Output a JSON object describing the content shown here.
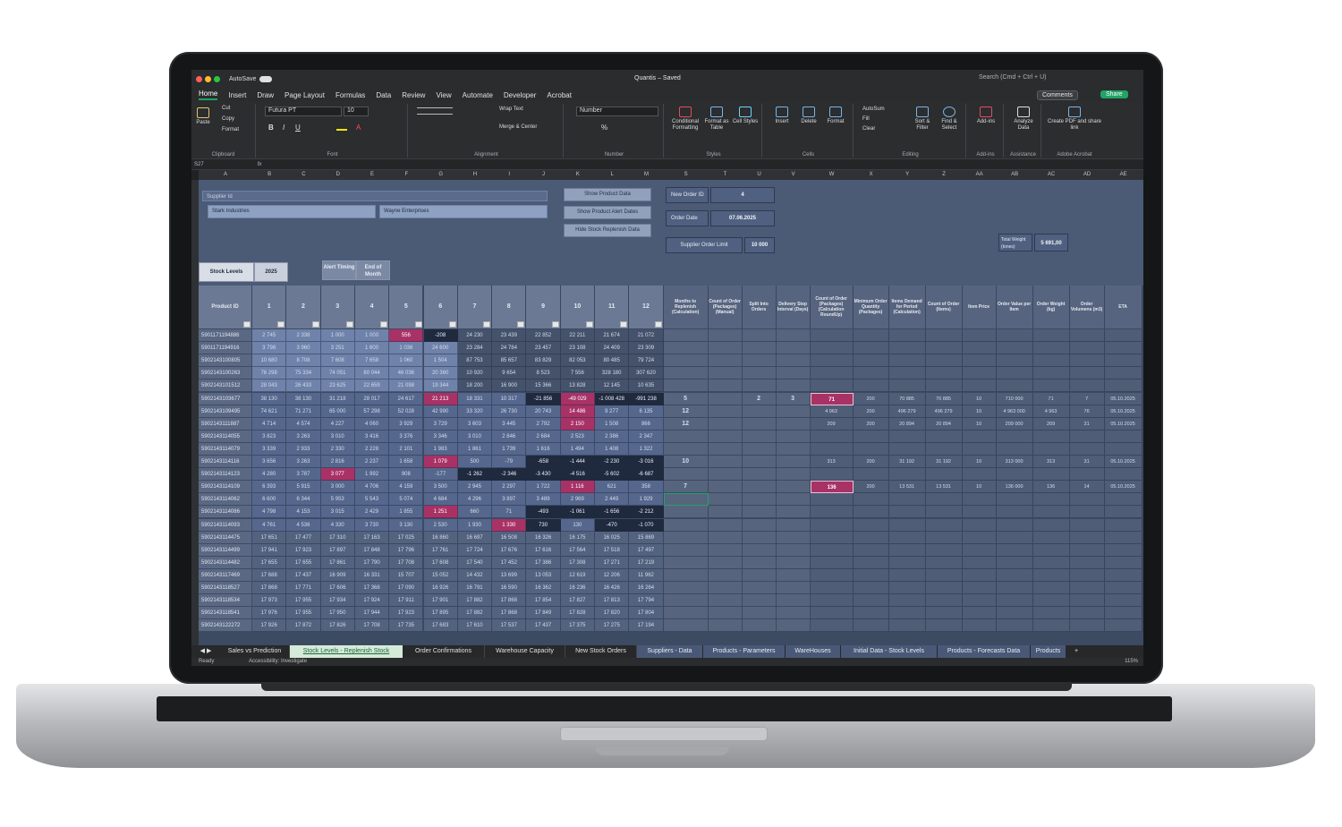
{
  "window": {
    "title": "Quantis – Saved",
    "autosave": "AutoSave",
    "search_placeholder": "Search (Cmd + Ctrl + U)",
    "comments": "Comments",
    "share": "Share"
  },
  "menu": [
    "Home",
    "Insert",
    "Draw",
    "Page Layout",
    "Formulas",
    "Data",
    "Review",
    "View",
    "Automate",
    "Developer",
    "Acrobat"
  ],
  "ribbon": {
    "paste": "Paste",
    "cut": "Cut",
    "copy": "Copy",
    "format": "Format",
    "clipboard": "Clipboard",
    "font_name": "Futura PT",
    "font_size": "10",
    "font_group": "Font",
    "wrap_text": "Wrap Text",
    "merge_center": "Merge & Center",
    "alignment": "Alignment",
    "number_format": "Number",
    "number_group": "Number",
    "conditional": "Conditional Formatting",
    "format_table": "Format as Table",
    "cell_styles": "Cell Styles",
    "styles": "Styles",
    "insert": "Insert",
    "delete": "Delete",
    "format2": "Format",
    "cells": "Cells",
    "autosum": "AutoSum",
    "fill": "Fill",
    "clear": "Clear",
    "sort_filter": "Sort & Filter",
    "find_select": "Find & Select",
    "editing": "Editing",
    "addins": "Add-ins",
    "addins_group": "Add-ins",
    "analyze": "Analyze Data",
    "assistance": "Assistance",
    "pdf": "Create PDF and share link",
    "acrobat": "Adobe Acrobat"
  },
  "namebox": "S27",
  "columns": [
    "A",
    "B",
    "C",
    "D",
    "E",
    "F",
    "G",
    "H",
    "I",
    "J",
    "K",
    "L",
    "M",
    "S",
    "T",
    "U",
    "V",
    "W",
    "X",
    "Y",
    "Z",
    "AA",
    "AB",
    "AC",
    "AD",
    "AE"
  ],
  "panel": {
    "supplier_label": "Supplier Id",
    "suppliers": [
      "Stark Industries",
      "Wayne Enterprises"
    ],
    "btn_product": "Show Product Data",
    "btn_alert": "Show Product Alert Dates",
    "btn_replenish": "Hide Stock Replenish Data",
    "new_order_label": "New Order ID",
    "new_order_value": "4",
    "order_date_label": "Order Date",
    "order_date_value": "07.06.2025",
    "limit_label": "Supplier Order Limit",
    "limit_value": "10 000",
    "weight_label": "Total Weight (tones)",
    "weight_value": "5 691,00",
    "stock_levels": "Stock Levels",
    "year": "2025",
    "alert_timing": "Alert Timing",
    "end_month": "End of Month"
  },
  "table_headers": {
    "product": "Product ID",
    "months": [
      "1",
      "2",
      "3",
      "4",
      "5",
      "6",
      "7",
      "8",
      "9",
      "10",
      "11",
      "12"
    ],
    "calc": [
      "Months to Replenish (Calculation)",
      "Count of Order (Packages) (Manual)",
      "Split Into Orders",
      "Delivery Step Interval (Days)",
      "Count of Order (Packages) (Calculation RoundUp)",
      "Minimum Order Quantity (Packages)",
      "Items Demand for Period (Calculation)",
      "Count of Order (Items)",
      "Item Price",
      "Order Value per Item",
      "Order Weight (kg)",
      "Order Volumens (m3)",
      "ETA"
    ]
  },
  "rows": [
    {
      "id": "5901171194886",
      "m": [
        "2 745",
        "2 338",
        "1 000",
        "1 000",
        "556",
        "-208",
        "24 230",
        "23 439",
        "22 852",
        "22 211",
        "21 674",
        "21 072"
      ],
      "c": [
        "",
        "",
        "",
        "",
        "",
        "",
        "",
        "",
        "",
        "",
        "",
        "",
        ""
      ]
    },
    {
      "id": "5901171194916",
      "m": [
        "3 798",
        "3 960",
        "3 251",
        "1 600",
        "1 036",
        "24 600",
        "23 284",
        "24 784",
        "23 457",
        "23 108",
        "24 409",
        "23 309"
      ],
      "c": [
        "",
        "",
        "",
        "",
        "",
        "",
        "",
        "",
        "",
        "",
        "",
        "",
        ""
      ]
    },
    {
      "id": "5902143100805",
      "m": [
        "10 680",
        "8 708",
        "7 608",
        "7 658",
        "1 060",
        "1 504",
        "87 753",
        "85 657",
        "83 829",
        "82 053",
        "80 485",
        "79 724"
      ],
      "c": [
        "",
        "",
        "",
        "",
        "",
        "",
        "",
        "",
        "",
        "",
        "",
        "",
        ""
      ]
    },
    {
      "id": "5902143100263",
      "m": [
        "76 298",
        "75 334",
        "74 051",
        "80 044",
        "46 036",
        "20 360",
        "10 920",
        "9 654",
        "8 523",
        "7 556",
        "328 180",
        "307 620"
      ],
      "c": [
        "",
        "",
        "",
        "",
        "",
        "",
        "",
        "",
        "",
        "",
        "",
        "",
        ""
      ]
    },
    {
      "id": "5902143101512",
      "m": [
        "28 043",
        "26 433",
        "23 625",
        "22 659",
        "21 098",
        "19 344",
        "18 200",
        "16 900",
        "15 366",
        "13 828",
        "12 145",
        "10 635"
      ],
      "c": [
        "",
        "",
        "",
        "",
        "",
        "",
        "",
        "",
        "",
        "",
        "",
        "",
        ""
      ]
    },
    {
      "id": "5902143103677",
      "m": [
        "38 130",
        "38 130",
        "31 218",
        "28 017",
        "24 617",
        "21 213",
        "18 331",
        "10 317",
        "-21 856",
        "-49 029",
        "-1 008 428",
        "-991 238"
      ],
      "c": [
        "5",
        "",
        "2",
        "3",
        "71",
        "200",
        "70 885",
        "70 885",
        "10",
        "710 000",
        "71",
        "7",
        "05.10.2025"
      ]
    },
    {
      "id": "5902143109495",
      "m": [
        "74 621",
        "71 271",
        "65 000",
        "57 298",
        "52 028",
        "42 990",
        "33 320",
        "26 730",
        "20 743",
        "14 486",
        "9 277",
        "6 135"
      ],
      "c": [
        "12",
        "",
        "",
        "",
        "4 963",
        "200",
        "496 279",
        "496 279",
        "10",
        "4 963 000",
        "4 963",
        "76",
        "05.10.2025"
      ]
    },
    {
      "id": "5902143111887",
      "m": [
        "4 714",
        "4 574",
        "4 227",
        "4 060",
        "3 929",
        "3 729",
        "3 603",
        "3 445",
        "2 792",
        "2 150",
        "1 508",
        "866"
      ],
      "c": [
        "12",
        "",
        "",
        "",
        "209",
        "200",
        "20 894",
        "20 894",
        "10",
        "209 000",
        "209",
        "31",
        "05.10.2025"
      ]
    },
    {
      "id": "5902143114055",
      "m": [
        "3 823",
        "3 263",
        "3 010",
        "3 416",
        "3 376",
        "3 346",
        "3 010",
        "2 846",
        "2 684",
        "2 523",
        "2 386",
        "2 347"
      ],
      "c": [
        "",
        "",
        "",
        "",
        "",
        "",
        "",
        "",
        "",
        "",
        "",
        "",
        ""
      ]
    },
    {
      "id": "5902143114079",
      "m": [
        "3 339",
        "2 933",
        "2 330",
        "2 228",
        "2 101",
        "1 983",
        "1 861",
        "1 739",
        "1 616",
        "1 494",
        "1 408",
        "1 322"
      ],
      "c": [
        "",
        "",
        "",
        "",
        "",
        "",
        "",
        "",
        "",
        "",
        "",
        "",
        ""
      ]
    },
    {
      "id": "5902143114116",
      "m": [
        "3 656",
        "3 263",
        "2 816",
        "2 237",
        "1 658",
        "1 079",
        "500",
        "-79",
        "-658",
        "-1 444",
        "-2 230",
        "-3 016"
      ],
      "c": [
        "10",
        "",
        "",
        "",
        "313",
        "200",
        "31 192",
        "31 192",
        "10",
        "313 000",
        "313",
        "31",
        "05.10.2025"
      ]
    },
    {
      "id": "5902143114123",
      "m": [
        "4 280",
        "3 787",
        "3 077",
        "1 992",
        "908",
        "-177",
        "-1 262",
        "-2 346",
        "-3 430",
        "-4 516",
        "-5 602",
        "-6 687"
      ],
      "c": [
        "",
        "",
        "",
        "",
        "",
        "",
        "",
        "",
        "",
        "",
        "",
        "",
        ""
      ]
    },
    {
      "id": "5902143114109",
      "m": [
        "6 393",
        "5 915",
        "3 000",
        "4 706",
        "4 159",
        "3 500",
        "2 945",
        "2 297",
        "1 722",
        "1 116",
        "621",
        "358"
      ],
      "c": [
        "7",
        "",
        "",
        "",
        "136",
        "200",
        "13 531",
        "13 531",
        "10",
        "136 000",
        "136",
        "14",
        "05.10.2025"
      ]
    },
    {
      "id": "5902143114062",
      "m": [
        "6 600",
        "6 344",
        "5 953",
        "5 543",
        "5 074",
        "4 684",
        "4 296",
        "3 897",
        "3 489",
        "2 969",
        "2 449",
        "1 929"
      ],
      "c": [
        "",
        "",
        "",
        "",
        "",
        "",
        "",
        "",
        "",
        "",
        "",
        "",
        ""
      ]
    },
    {
      "id": "5902143114086",
      "m": [
        "4 798",
        "4 153",
        "3 015",
        "2 429",
        "1 855",
        "1 251",
        "660",
        "71",
        "-493",
        "-1 061",
        "-1 656",
        "-2 212"
      ],
      "c": [
        "",
        "",
        "",
        "",
        "",
        "",
        "",
        "",
        "",
        "",
        "",
        "",
        ""
      ]
    },
    {
      "id": "5902143114093",
      "m": [
        "4 761",
        "4 536",
        "4 330",
        "3 730",
        "3 130",
        "2 530",
        "1 930",
        "1 330",
        "730",
        "130",
        "-470",
        "-1 070"
      ],
      "c": [
        "",
        "",
        "",
        "",
        "",
        "",
        "",
        "",
        "",
        "",
        "",
        "",
        ""
      ]
    },
    {
      "id": "5902143114475",
      "m": [
        "17 651",
        "17 477",
        "17 310",
        "17 163",
        "17 025",
        "16 860",
        "16 697",
        "16 508",
        "16 326",
        "16 175",
        "16 025",
        "15 869"
      ],
      "c": [
        "",
        "",
        "",
        "",
        "",
        "",
        "",
        "",
        "",
        "",
        "",
        "",
        ""
      ]
    },
    {
      "id": "5902143114499",
      "m": [
        "17 941",
        "17 923",
        "17 897",
        "17 848",
        "17 796",
        "17 761",
        "17 724",
        "17 676",
        "17 616",
        "17 564",
        "17 518",
        "17 497"
      ],
      "c": [
        "",
        "",
        "",
        "",
        "",
        "",
        "",
        "",
        "",
        "",
        "",
        "",
        ""
      ]
    },
    {
      "id": "5902143114482",
      "m": [
        "17 655",
        "17 655",
        "17 861",
        "17 790",
        "17 708",
        "17 608",
        "17 540",
        "17 452",
        "17 386",
        "17 308",
        "17 271",
        "17 219"
      ],
      "c": [
        "",
        "",
        "",
        "",
        "",
        "",
        "",
        "",
        "",
        "",
        "",
        "",
        ""
      ]
    },
    {
      "id": "5902143117469",
      "m": [
        "17 688",
        "17 437",
        "16 909",
        "16 331",
        "15 707",
        "15 052",
        "14 432",
        "13 699",
        "13 053",
        "12 619",
        "12 206",
        "11 962"
      ],
      "c": [
        "",
        "",
        "",
        "",
        "",
        "",
        "",
        "",
        "",
        "",
        "",
        "",
        ""
      ]
    },
    {
      "id": "5902143118527",
      "m": [
        "17 868",
        "17 771",
        "17 606",
        "17 368",
        "17 090",
        "16 926",
        "16 791",
        "16 590",
        "16 362",
        "16 236",
        "16 426",
        "16 264"
      ],
      "c": [
        "",
        "",
        "",
        "",
        "",
        "",
        "",
        "",
        "",
        "",
        "",
        "",
        ""
      ]
    },
    {
      "id": "5902143118534",
      "m": [
        "17 973",
        "17 955",
        "17 934",
        "17 924",
        "17 911",
        "17 901",
        "17 882",
        "17 868",
        "17 854",
        "17 827",
        "17 813",
        "17 794"
      ],
      "c": [
        "",
        "",
        "",
        "",
        "",
        "",
        "",
        "",
        "",
        "",
        "",
        "",
        ""
      ]
    },
    {
      "id": "5902143118541",
      "m": [
        "17 976",
        "17 955",
        "17 950",
        "17 944",
        "17 923",
        "17 895",
        "17 882",
        "17 868",
        "17 849",
        "17 828",
        "17 820",
        "17 804"
      ],
      "c": [
        "",
        "",
        "",
        "",
        "",
        "",
        "",
        "",
        "",
        "",
        "",
        "",
        ""
      ]
    },
    {
      "id": "5902143122272",
      "m": [
        "17 926",
        "17 872",
        "17 826",
        "17 708",
        "17 735",
        "17 683",
        "17 610",
        "17 537",
        "17 437",
        "17 375",
        "17 275",
        "17 194"
      ],
      "c": [
        "",
        "",
        "",
        "",
        "",
        "",
        "",
        "",
        "",
        "",
        "",
        "",
        ""
      ]
    }
  ],
  "highlights": {
    "red": [
      "0-4",
      "5-5",
      "11-2",
      "14-5",
      "5-9",
      "6-9",
      "7-9",
      "12-9",
      "15-7",
      "10-5"
    ],
    "dark": [
      "0-5",
      "5-8",
      "5-10",
      "5-11",
      "10-8",
      "10-9",
      "10-10",
      "10-11",
      "11-6",
      "11-7",
      "11-8",
      "11-9",
      "11-10",
      "11-11",
      "14-8",
      "14-9",
      "14-10",
      "14-11",
      "15-8",
      "15-10",
      "15-11"
    ]
  },
  "tabs": [
    "Sales vs Prediction",
    "Stock Levels - Replenish Stock",
    "Order Confirmations",
    "Warehouse Capacity",
    "New Stock Orders",
    "Suppliers - Data",
    "Products - Parameters",
    "WareHouses",
    "Initial Data - Stock Levels",
    "Products - Forecasts Data",
    "Products"
  ],
  "status": {
    "ready": "Ready",
    "accessibility": "Accessibility: Investigate",
    "zoom": "115%"
  }
}
